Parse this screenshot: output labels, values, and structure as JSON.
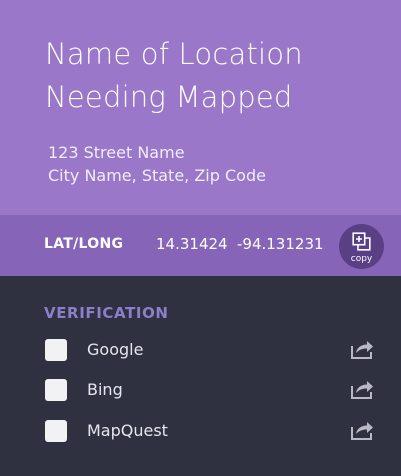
{
  "location": {
    "title_line1": "Name of Location",
    "title_line2": "Needing Mapped",
    "address_line1": "123 Street Name",
    "address_line2": "City Name, State, Zip Code"
  },
  "coords": {
    "label": "LAT/LONG",
    "lat": "14.31424",
    "long": "-94.131231",
    "copy_label": "copy",
    "copy_icon": "copy-icon"
  },
  "verification": {
    "title": "VERIFICATION",
    "items": [
      {
        "label": "Google",
        "checked": false,
        "icon": "share-icon"
      },
      {
        "label": "Bing",
        "checked": false,
        "icon": "share-icon"
      },
      {
        "label": "MapQuest",
        "checked": false,
        "icon": "share-icon"
      }
    ]
  },
  "colors": {
    "header_bg": "#9a77c8",
    "coords_bg": "#8664b8",
    "copy_button_bg": "#5a3f84",
    "panel_bg": "#2f3140",
    "section_title": "#8a7fc8"
  }
}
